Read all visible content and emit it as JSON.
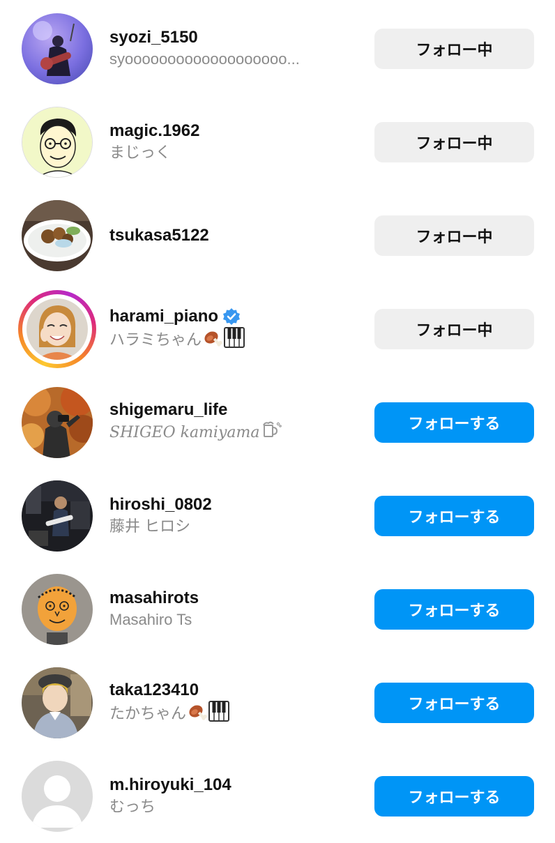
{
  "users": [
    {
      "username": "syozi_5150",
      "subname": "syooooooooooooooooooo...",
      "button": "フォロー中",
      "state": "following",
      "avatar": "guitarist-photo"
    },
    {
      "username": "magic.1962",
      "subname": "まじっく",
      "button": "フォロー中",
      "state": "following",
      "avatar": "cartoon-glasses-face"
    },
    {
      "username": "tsukasa5122",
      "subname": "",
      "button": "フォロー中",
      "state": "following",
      "avatar": "food-plate-photo"
    },
    {
      "username": "harami_piano",
      "subname": "ハラミちゃん",
      "button": "フォロー中",
      "state": "following",
      "avatar": "smiling-woman-photo",
      "verified": true,
      "emojis": [
        "meat-on-bone-icon",
        "piano-keys-icon"
      ],
      "has_story_ring": true
    },
    {
      "username": "shigemaru_life",
      "subname": "SHIGEO kamiyama",
      "button": "フォローする",
      "state": "follow",
      "avatar": "autumn-photographer-photo",
      "emojis": [
        "beer-mug-icon"
      ]
    },
    {
      "username": "hiroshi_0802",
      "subname": "藤井 ヒロシ",
      "button": "フォローする",
      "state": "follow",
      "avatar": "stage-guitarist-photo"
    },
    {
      "username": "masahirots",
      "subname": "Masahiro Ts",
      "button": "フォローする",
      "state": "follow",
      "avatar": "cartoon-orange-face"
    },
    {
      "username": "taka123410",
      "subname": "たかちゃん",
      "button": "フォローする",
      "state": "follow",
      "avatar": "woman-in-beret-photo",
      "emojis": [
        "meat-on-bone-icon",
        "piano-keys-icon"
      ]
    },
    {
      "username": "m.hiroyuki_104",
      "subname": "むっち",
      "button": "フォローする",
      "state": "follow",
      "avatar": "default-avatar"
    }
  ],
  "colors": {
    "follow_blue": "#0095f6",
    "following_gray": "#efefef",
    "verified_blue": "#3897f0",
    "subtext_gray": "#8a8a8a"
  }
}
